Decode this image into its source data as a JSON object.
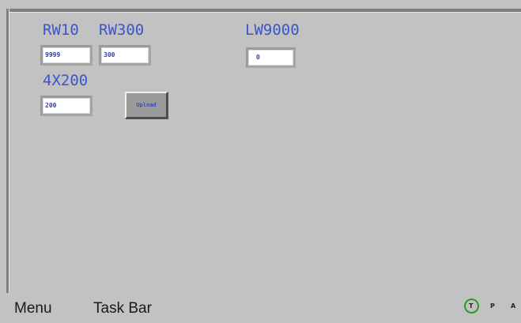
{
  "labels": {
    "rw10": "RW10",
    "rw300": "RW300",
    "lw9000": "LW9000",
    "x4200": "4X200"
  },
  "fields": {
    "rw10": "9999",
    "rw300": "300",
    "lw9000": "0",
    "x4200": "200"
  },
  "buttons": {
    "upload": "Upload"
  },
  "taskbar": {
    "menu": "Menu",
    "task_bar": "Task Bar",
    "t": "T",
    "p": "P",
    "a": "A"
  },
  "colors": {
    "background": "#c2c2c2",
    "label_text": "#3a55c9",
    "indicator_ring": "#2e9a2e"
  }
}
